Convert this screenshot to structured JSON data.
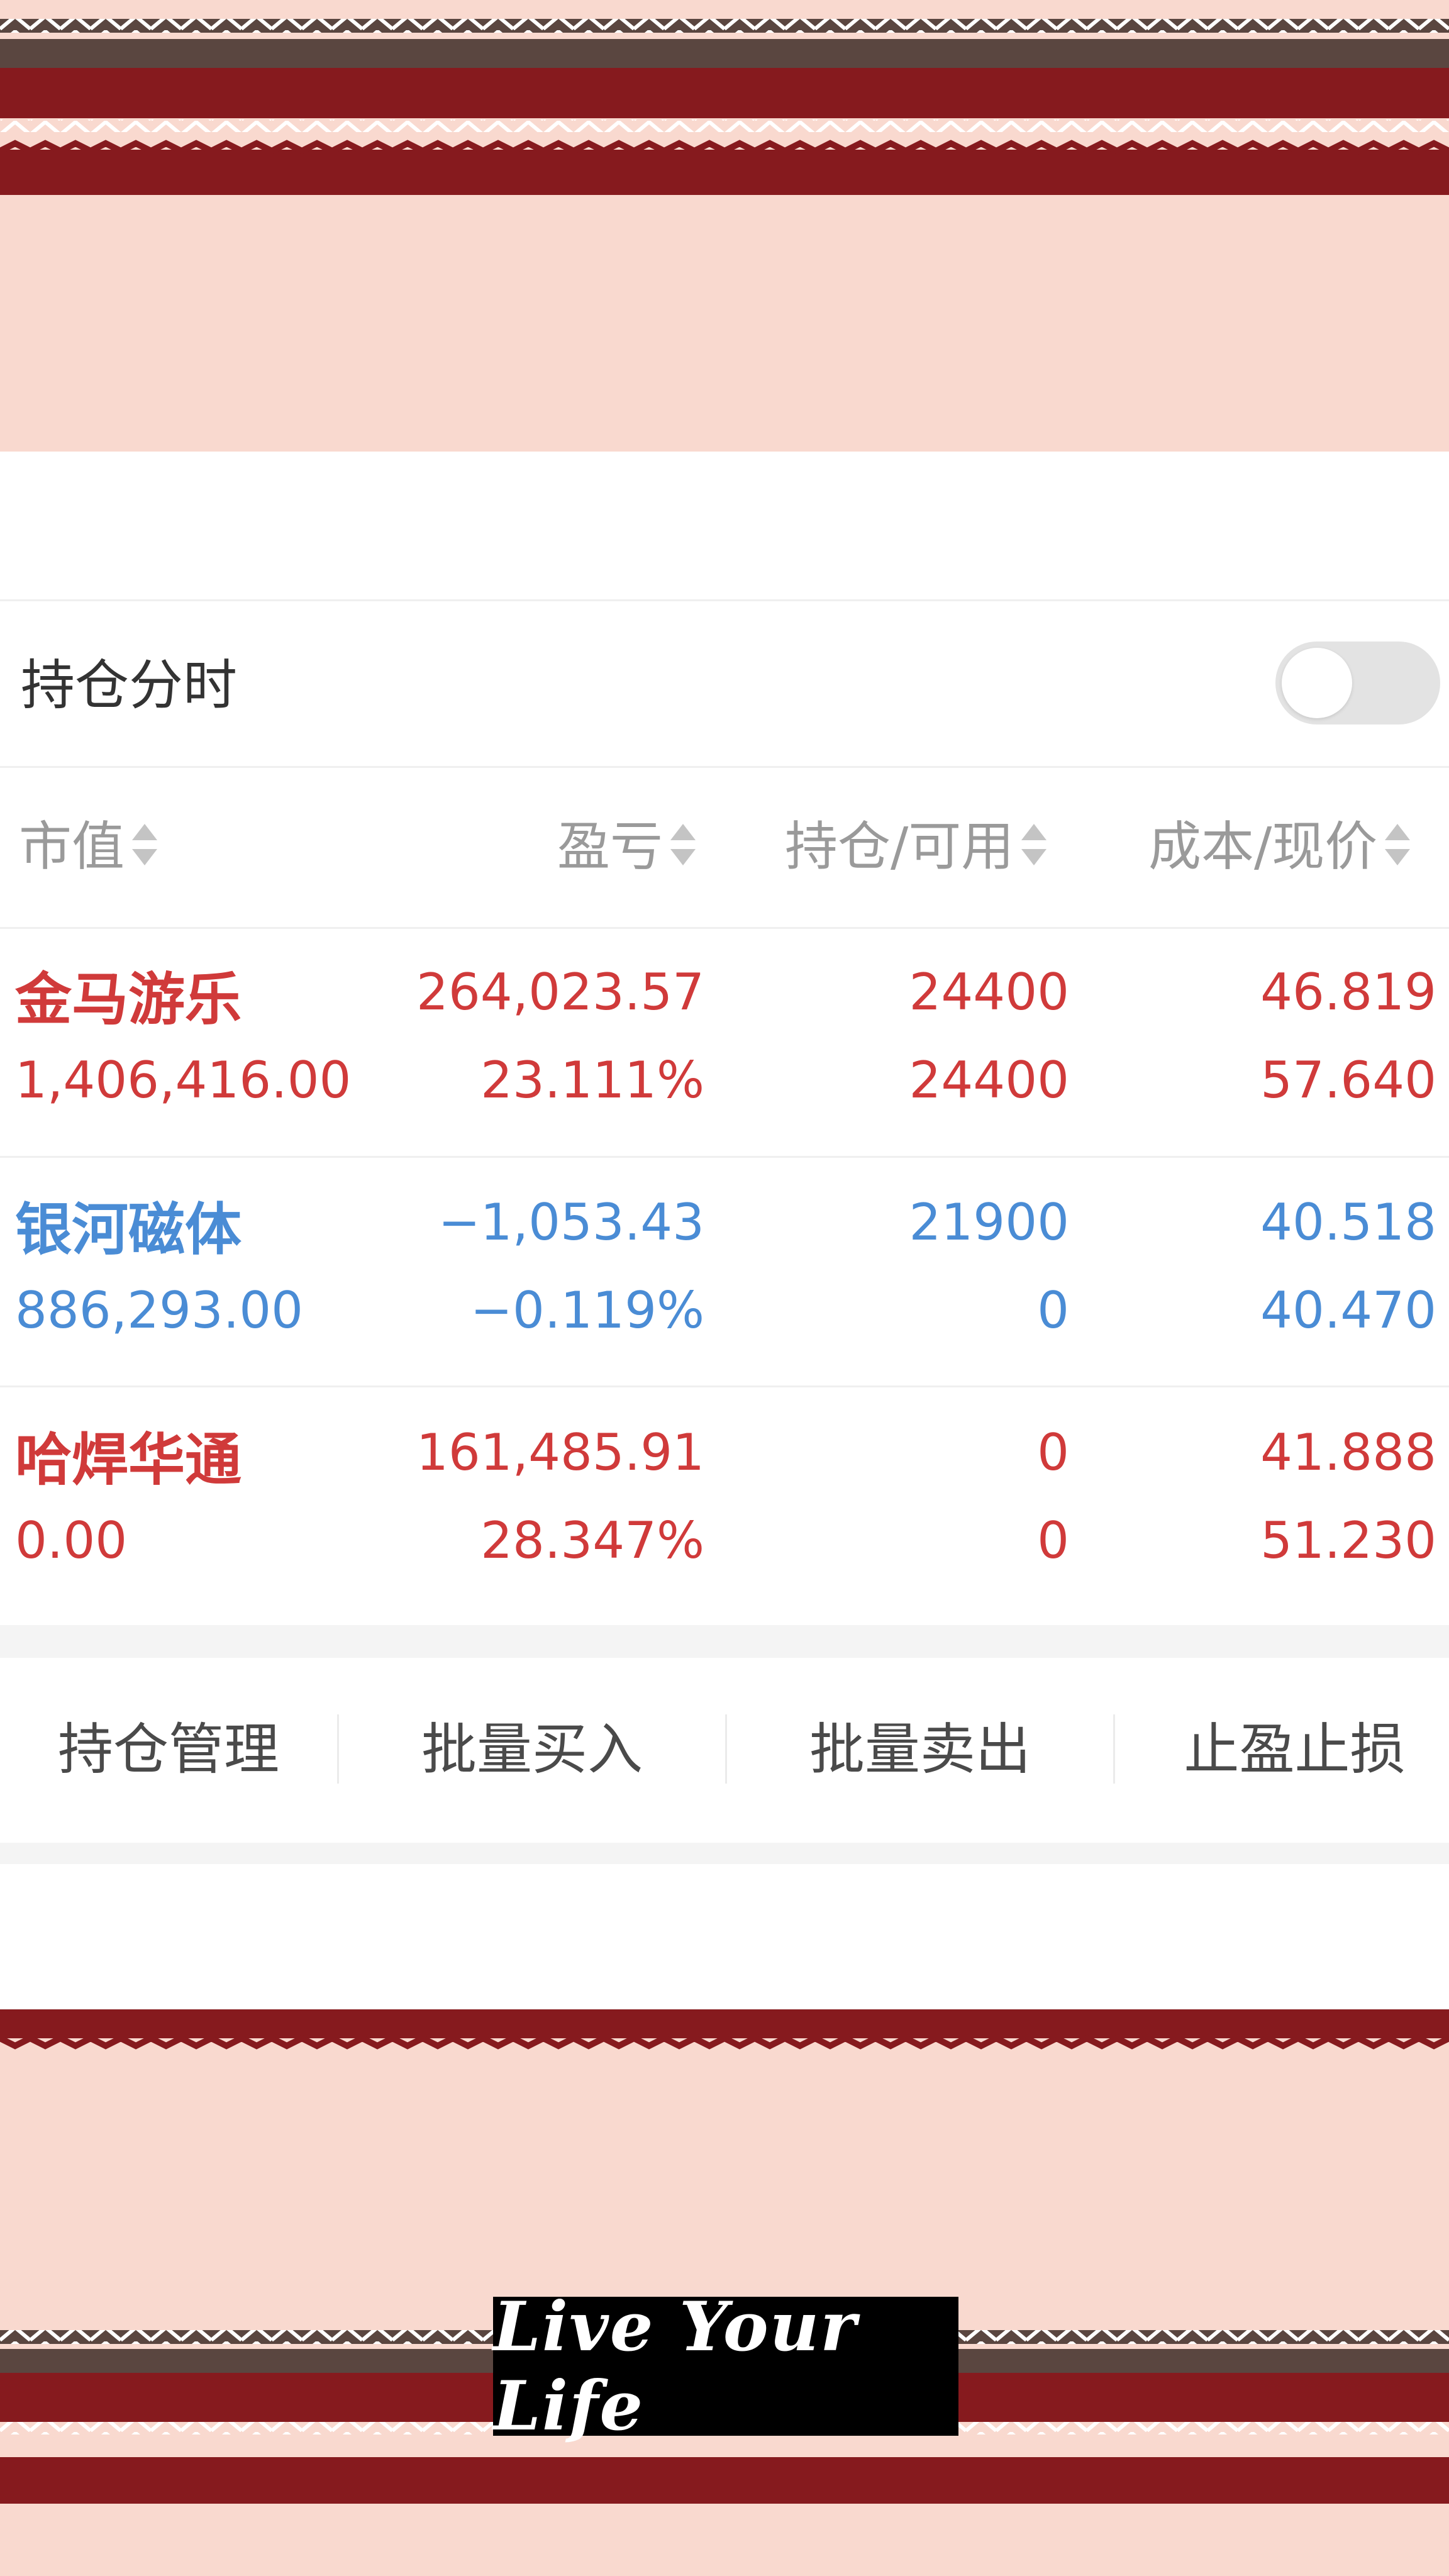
{
  "colors": {
    "gain": "#d03a3a",
    "loss": "#4a8cd5",
    "decor_pink": "#f9d9cf",
    "decor_red": "#861a1e",
    "decor_brown": "#5a4640"
  },
  "toggle": {
    "label": "持仓分时",
    "enabled": false
  },
  "table": {
    "headers": [
      "市值",
      "盈亏",
      "持仓/可用",
      "成本/现价"
    ],
    "rows": [
      {
        "name": "金马游乐",
        "market_value": "1,406,416.00",
        "pnl": "264,023.57",
        "pnl_pct": "23.111%",
        "position": "24400",
        "available": "24400",
        "cost": "46.819",
        "price": "57.640",
        "trend": "gain"
      },
      {
        "name": "银河磁体",
        "market_value": "886,293.00",
        "pnl": "−1,053.43",
        "pnl_pct": "−0.119%",
        "position": "21900",
        "available": "0",
        "cost": "40.518",
        "price": "40.470",
        "trend": "loss"
      },
      {
        "name": "哈焊华通",
        "market_value": "0.00",
        "pnl": "161,485.91",
        "pnl_pct": "28.347%",
        "position": "0",
        "available": "0",
        "cost": "41.888",
        "price": "51.230",
        "trend": "gain"
      }
    ]
  },
  "actions": [
    "持仓管理",
    "批量买入",
    "批量卖出",
    "止盈止损"
  ],
  "decor": {
    "badge_text": "Live Your Life"
  }
}
